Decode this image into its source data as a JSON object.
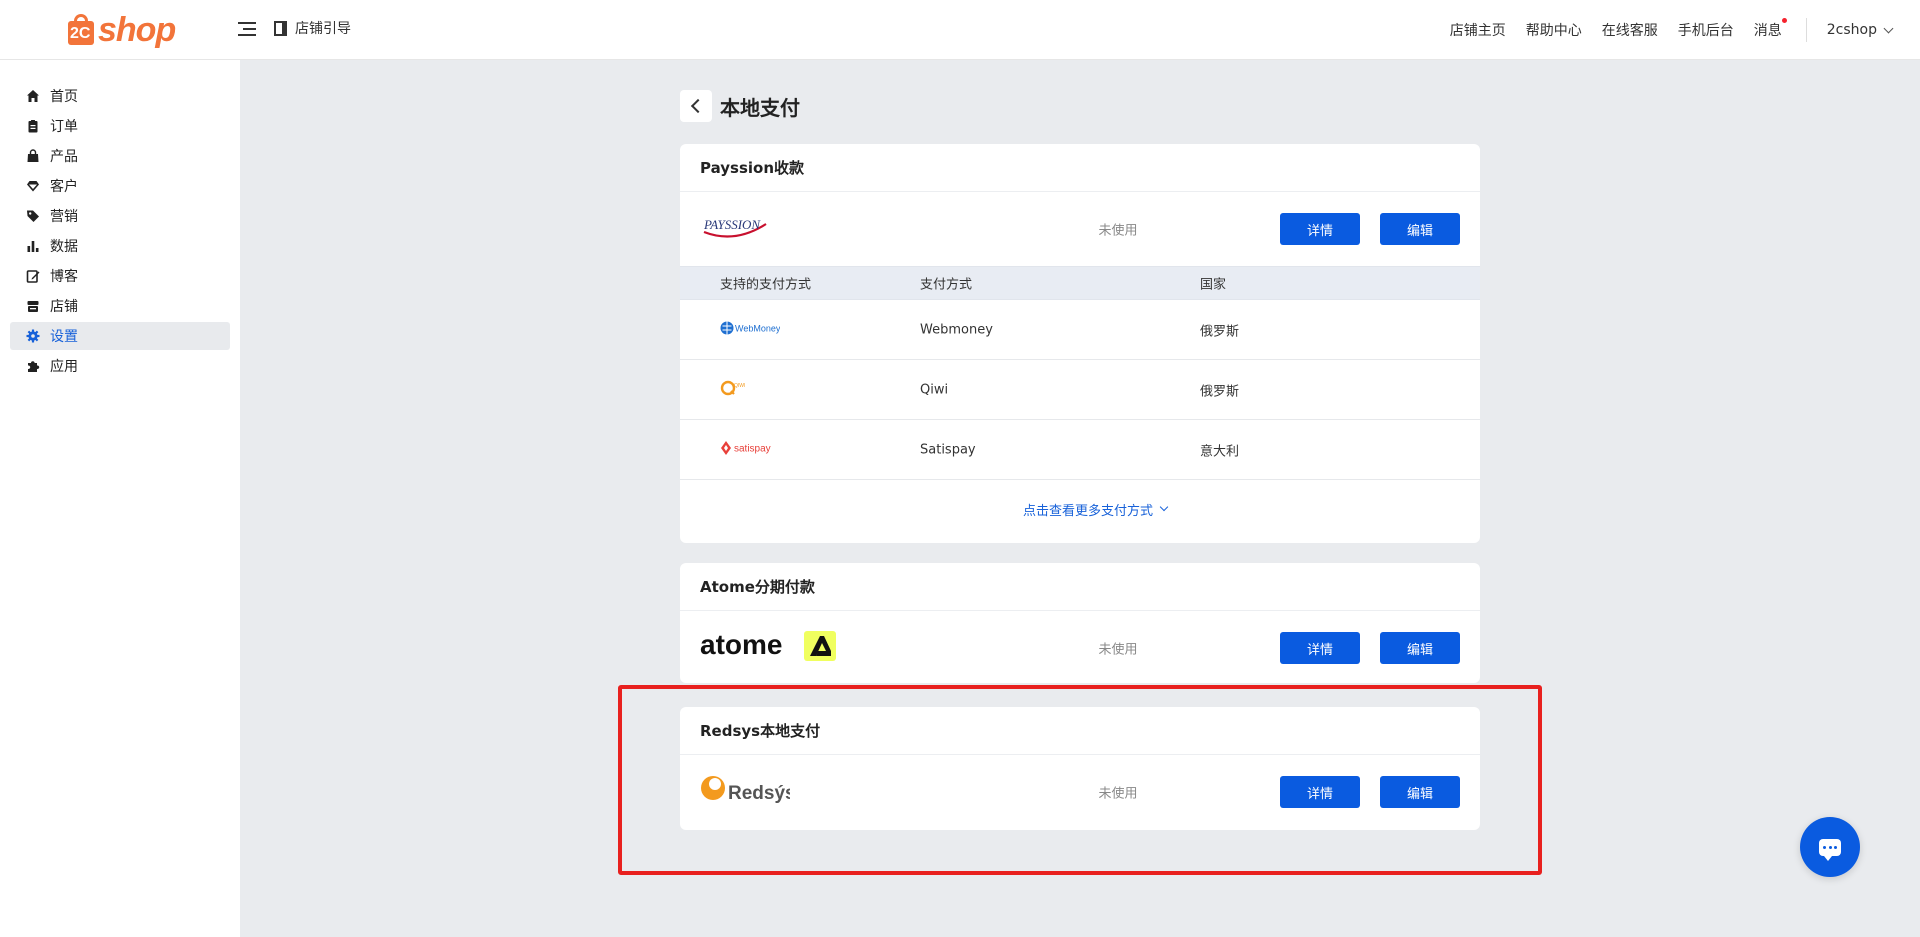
{
  "header": {
    "logo_text": "shop",
    "logo_num": "2C",
    "guide_label": "店铺引导",
    "nav": [
      "店铺主页",
      "帮助中心",
      "在线客服",
      "手机后台",
      "消息"
    ],
    "user": "2cshop"
  },
  "sidebar": {
    "items": [
      {
        "label": "首页",
        "icon": "home-icon"
      },
      {
        "label": "订单",
        "icon": "clipboard-icon"
      },
      {
        "label": "产品",
        "icon": "bag-icon"
      },
      {
        "label": "客户",
        "icon": "diamond-icon"
      },
      {
        "label": "营销",
        "icon": "tag-icon"
      },
      {
        "label": "数据",
        "icon": "bar-chart-icon"
      },
      {
        "label": "博客",
        "icon": "edit-icon"
      },
      {
        "label": "店铺",
        "icon": "store-icon"
      },
      {
        "label": "设置",
        "icon": "gear-icon"
      },
      {
        "label": "应用",
        "icon": "puzzle-icon"
      }
    ],
    "active": "设置"
  },
  "page": {
    "title": "本地支付"
  },
  "cards": {
    "payssion": {
      "title": "Payssion收款",
      "logo_text": "PAYSSION",
      "status": "未使用",
      "detail_label": "详情",
      "edit_label": "编辑",
      "table": {
        "headers": [
          "支持的支付方式",
          "支付方式",
          "国家"
        ],
        "rows": [
          {
            "logo": "WebMoney",
            "method": "Webmoney",
            "country": "俄罗斯"
          },
          {
            "logo": "QIWI",
            "method": "Qiwi",
            "country": "俄罗斯"
          },
          {
            "logo": "satispay",
            "method": "Satispay",
            "country": "意大利"
          }
        ]
      },
      "more_label": "点击查看更多支付方式"
    },
    "atome": {
      "title": "Atome分期付款",
      "logo_text": "atome",
      "status": "未使用",
      "detail_label": "详情",
      "edit_label": "编辑"
    },
    "redsys": {
      "title": "Redsys本地支付",
      "logo_text": "Redsýs",
      "status": "未使用",
      "detail_label": "详情",
      "edit_label": "编辑"
    }
  },
  "colors": {
    "brand": "#f2743a",
    "primary": "#0a5be0",
    "highlight": "#e8201e"
  }
}
